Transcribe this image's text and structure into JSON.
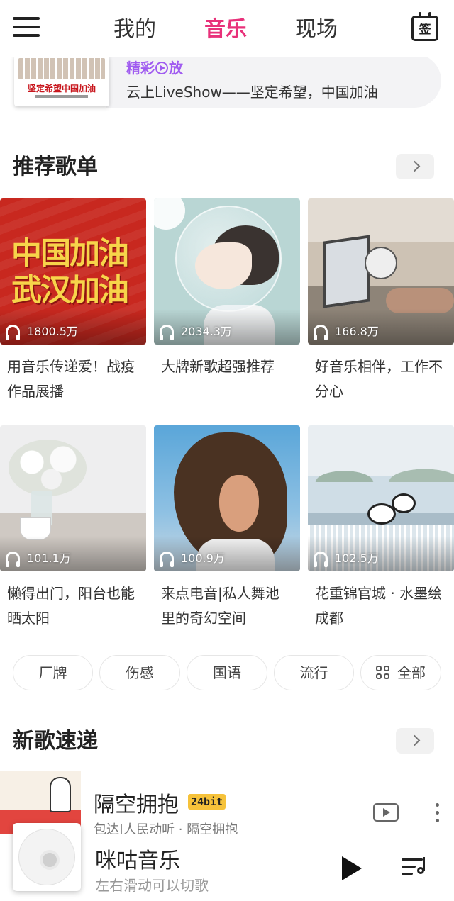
{
  "nav": {
    "tabs": [
      {
        "label": "我的",
        "active": false
      },
      {
        "label": "音乐",
        "active": true
      },
      {
        "label": "现场",
        "active": false
      }
    ],
    "calendar_label": "签",
    "accent_color": "#e8317a"
  },
  "banner": {
    "tag_part1": "精彩",
    "tag_part2": "放",
    "subtitle": "云上LiveShow——坚定希望，中国加油",
    "image_text": "坚定希望中国加油",
    "tag_color": "#a05cf0"
  },
  "recommended": {
    "title": "推荐歌单",
    "playlists": [
      {
        "title": "用音乐传递爱！战疫作品展播",
        "plays": "1800.5万",
        "cover_text_line1": "中国加油",
        "cover_text_line2": "武汉加油"
      },
      {
        "title": "大牌新歌超强推荐",
        "plays": "2034.3万"
      },
      {
        "title": "好音乐相伴，工作不分心",
        "plays": "166.8万"
      },
      {
        "title": "懒得出门，阳台也能晒太阳",
        "plays": "101.1万"
      },
      {
        "title": "来点电音|私人舞池里的奇幻空间",
        "plays": "100.9万"
      },
      {
        "title": "花重锦官城 · 水墨绘成都",
        "plays": "102.5万"
      }
    ]
  },
  "categories": [
    "厂牌",
    "伤感",
    "国语",
    "流行",
    "全部"
  ],
  "new_songs": {
    "title": "新歌速递",
    "songs": [
      {
        "title": "隔空拥抱",
        "badge": "24bit",
        "subtitle": "包达|人民动听 · 隔空拥抱"
      }
    ]
  },
  "player": {
    "title": "咪咕音乐",
    "subtitle": "左右滑动可以切歌"
  },
  "icons": [
    "hamburger-icon",
    "calendar-sign-icon",
    "play-circle-icon",
    "chevron-right-icon",
    "headphone-icon",
    "grid-icon",
    "mv-icon",
    "more-vertical-icon",
    "play-icon",
    "playlist-icon"
  ]
}
